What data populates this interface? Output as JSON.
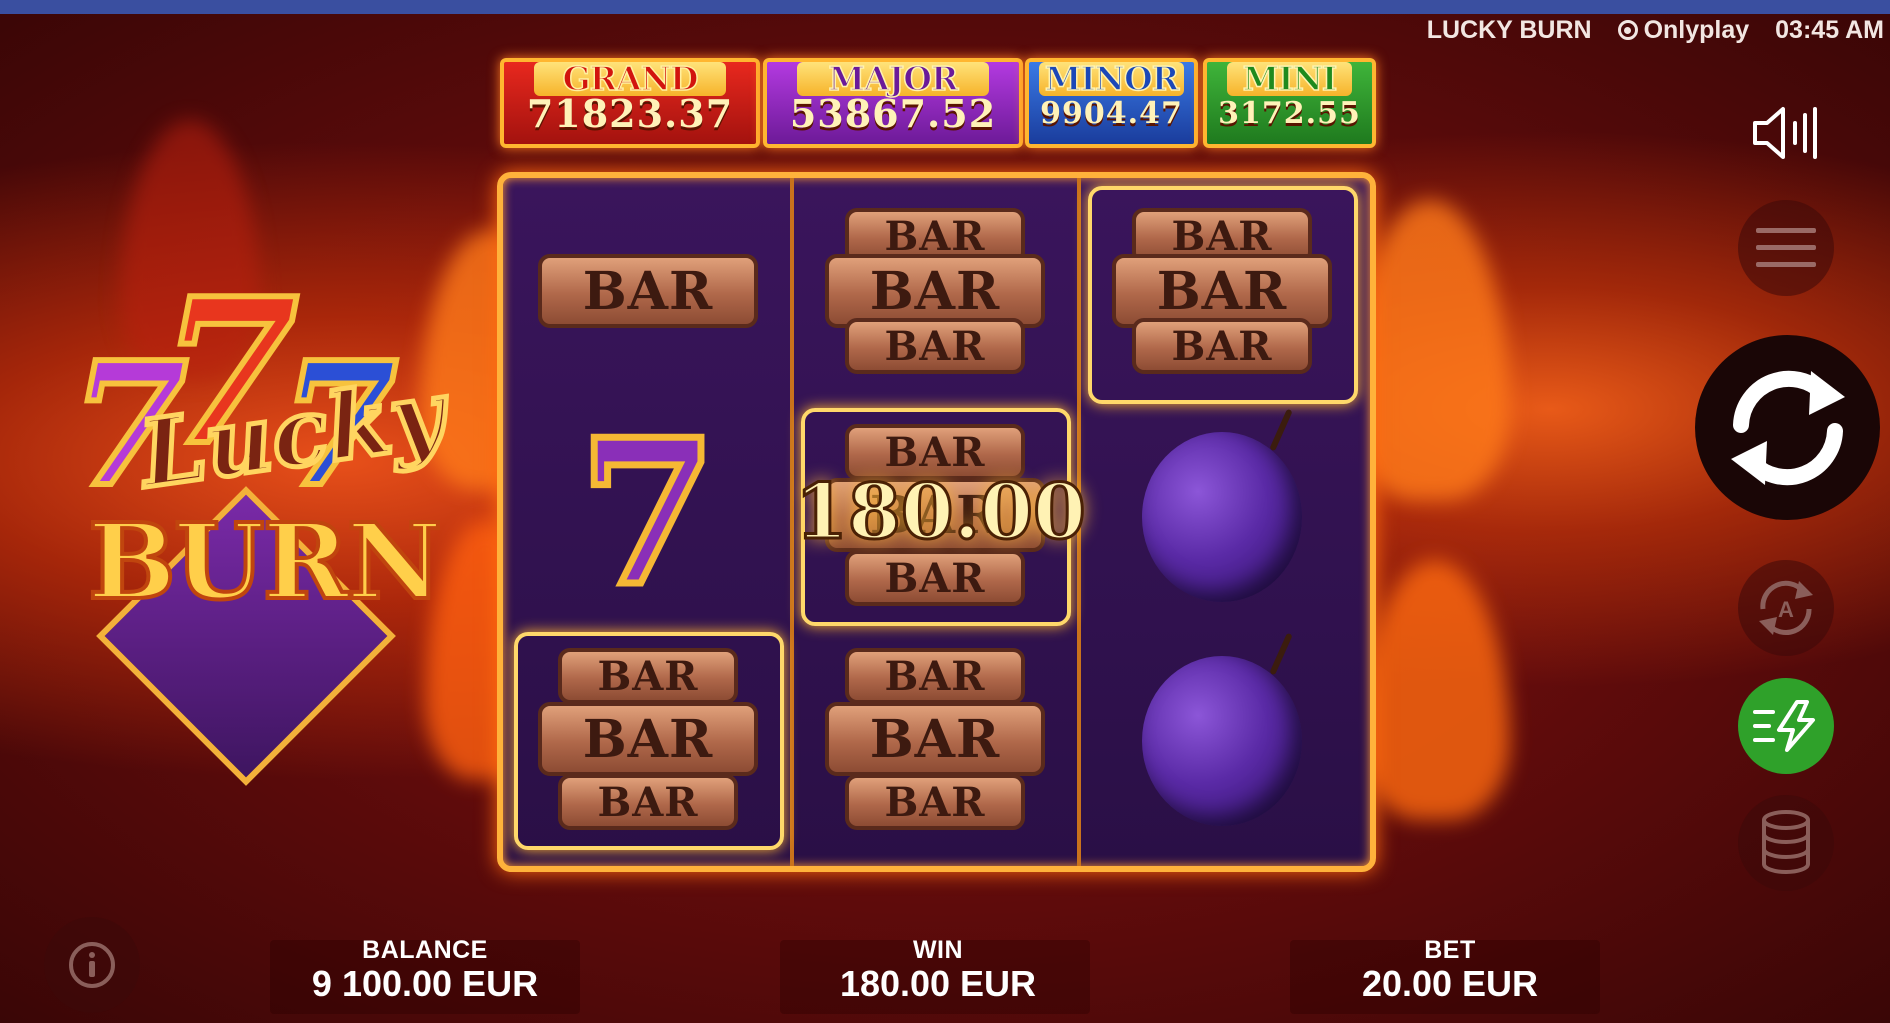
{
  "header": {
    "game_title": "LUCKY BURN",
    "provider": "Onlyplay",
    "clock": "03:45 AM"
  },
  "logo": {
    "line1": "Lucky",
    "line2": "BURN",
    "sevens": "777"
  },
  "jackpots": [
    {
      "label": "GRAND",
      "value": "71823.37",
      "color": "#d91e1e"
    },
    {
      "label": "MAJOR",
      "value": "53867.52",
      "color": "#9b2bc2"
    },
    {
      "label": "MINOR",
      "value": "9904.47",
      "color": "#1f56c9"
    },
    {
      "label": "MINI",
      "value": "3172.55",
      "color": "#2b9a2a"
    }
  ],
  "reels": [
    [
      "BAR",
      "7",
      "BAR"
    ],
    [
      "BAR",
      "BAR",
      "BAR"
    ],
    [
      "BAR",
      "plum",
      "plum"
    ]
  ],
  "win_display": "180.00",
  "bottom": {
    "balance_label": "BALANCE",
    "balance_value": "9 100.00 EUR",
    "win_label": "WIN",
    "win_value": "180.00 EUR",
    "bet_label": "BET",
    "bet_value": "20.00 EUR"
  },
  "controls": {
    "sound": "sound-icon",
    "menu": "menu-icon",
    "spin": "spin-icon",
    "autoplay": "autoplay-icon",
    "turbo": "turbo-icon",
    "bet": "coins-icon",
    "info": "info-icon"
  },
  "colors": {
    "frame": "#ffb23b",
    "reel_bg": "#2a0f46",
    "turbo_active": "#2fa12a"
  }
}
